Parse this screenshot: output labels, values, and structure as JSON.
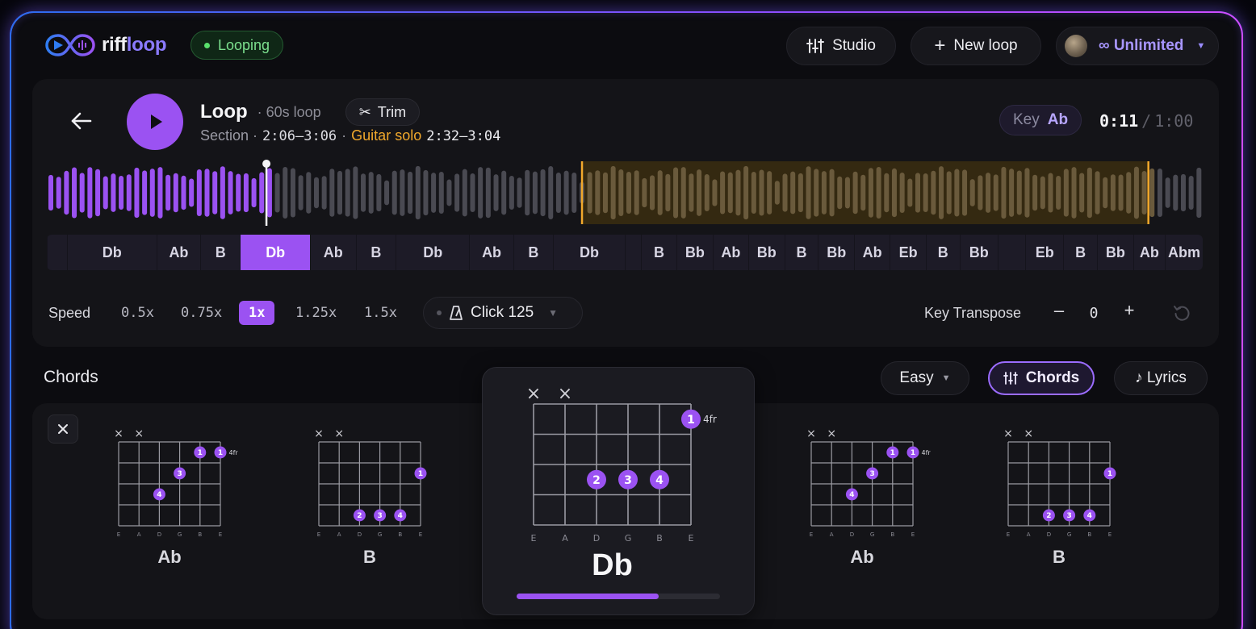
{
  "app": {
    "logo_a": "riff",
    "logo_b": "loop",
    "status": "Looping",
    "accent": "#9b52f2"
  },
  "topbar": {
    "studio_label": "Studio",
    "new_loop_label": "New loop",
    "plan_label": "∞ Unlimited"
  },
  "player": {
    "title": "Loop",
    "length": "· 60s loop",
    "trim_label": "Trim",
    "section_label": "Section ·",
    "section_range": "2:06–3:06",
    "solo_sep": "·",
    "solo_label": "Guitar solo",
    "solo_range": "2:32–3:04",
    "key_label": "Key",
    "key_value": "Ab",
    "time_current": "0:11",
    "time_sep": "/",
    "time_total": "1:00",
    "playhead_fraction": 0.19
  },
  "chord_strip": [
    {
      "label": "",
      "w": 1
    },
    {
      "label": "Db",
      "w": 4.5
    },
    {
      "label": "Ab",
      "w": 2.2
    },
    {
      "label": "B",
      "w": 2
    },
    {
      "label": "Db",
      "w": 3.5,
      "active": true
    },
    {
      "label": "Ab",
      "w": 2.3
    },
    {
      "label": "B",
      "w": 2
    },
    {
      "label": "Db",
      "w": 3.7
    },
    {
      "label": "Ab",
      "w": 2.2
    },
    {
      "label": "B",
      "w": 2
    },
    {
      "label": "Db",
      "w": 3.6
    },
    {
      "label": "",
      "w": 0.8
    },
    {
      "label": "B",
      "w": 1.8
    },
    {
      "label": "Bb",
      "w": 1.8
    },
    {
      "label": "Ab",
      "w": 1.8
    },
    {
      "label": "Bb",
      "w": 1.8
    },
    {
      "label": "B",
      "w": 1.7
    },
    {
      "label": "Bb",
      "w": 1.8
    },
    {
      "label": "Ab",
      "w": 1.8
    },
    {
      "label": "Eb",
      "w": 1.8
    },
    {
      "label": "B",
      "w": 1.7
    },
    {
      "label": "Bb",
      "w": 1.9
    },
    {
      "label": "",
      "w": 1.4
    },
    {
      "label": "Eb",
      "w": 1.9
    },
    {
      "label": "B",
      "w": 1.7
    },
    {
      "label": "Bb",
      "w": 1.8
    },
    {
      "label": "Ab",
      "w": 1.6
    },
    {
      "label": "Abm",
      "w": 1.9
    }
  ],
  "controls": {
    "speed_label": "Speed",
    "speeds": [
      "0.5x",
      "0.75x",
      "1x",
      "1.25x",
      "1.5x"
    ],
    "speed_active": "1x",
    "click_label": "Click 125",
    "key_transpose_label": "Key Transpose",
    "transpose_minus": "–",
    "transpose_value": "0",
    "transpose_plus": "+"
  },
  "chords_section": {
    "title": "Chords",
    "difficulty": "Easy",
    "chords_tab": "Chords",
    "lyrics_tab": "♪ Lyrics",
    "strings": [
      "E",
      "A",
      "D",
      "G",
      "B",
      "E"
    ],
    "mute_symbol": "×",
    "cards": [
      {
        "name": "Ab",
        "fret_label": "4fr"
      },
      {
        "name": "B",
        "fret_label": ""
      },
      {
        "name": "Db",
        "fret_label": "4fr",
        "focused": true
      },
      {
        "name": "Ab",
        "fret_label": "4fr"
      },
      {
        "name": "B",
        "fret_label": ""
      }
    ],
    "focus_progress": 0.7
  }
}
